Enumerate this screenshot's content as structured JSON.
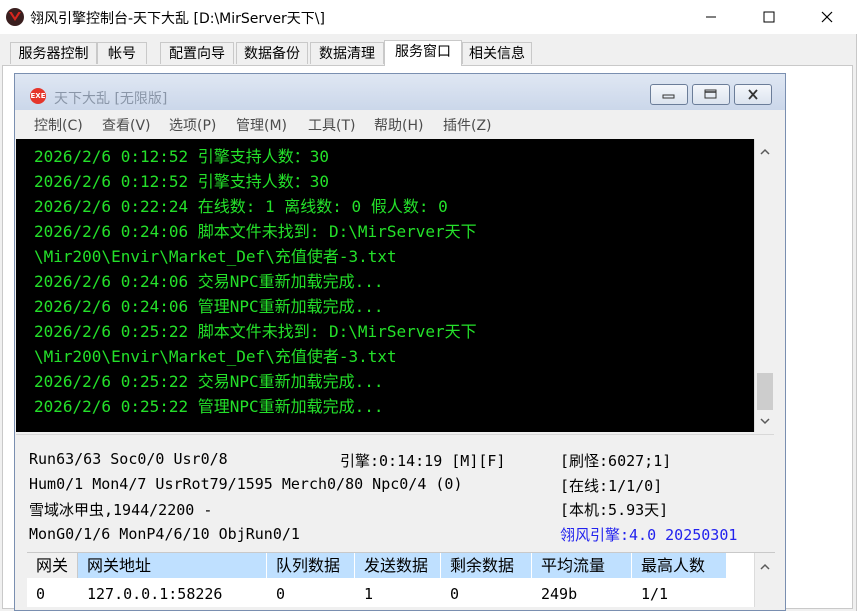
{
  "window": {
    "title": "翎风引擎控制台-天下大乱 [D:\\MirServer天下\\]"
  },
  "tabs": [
    {
      "label": "服务器控制",
      "active": false
    },
    {
      "label": "帐号",
      "active": false
    },
    {
      "label": "配置向导",
      "active": false
    },
    {
      "label": "数据备份",
      "active": false
    },
    {
      "label": "数据清理",
      "active": false
    },
    {
      "label": "服务窗口",
      "active": true
    },
    {
      "label": "相关信息",
      "active": false
    }
  ],
  "child": {
    "title": "天下大乱 [无限版]",
    "icon_label": "EXE",
    "menu": [
      "控制(C)",
      "查看(V)",
      "选项(P)",
      "管理(M)",
      "工具(T)",
      "帮助(H)",
      "插件(Z)"
    ]
  },
  "log": [
    {
      "text": "2026/2/6 0:12:52 引擎支持人数：30",
      "highlight": true
    },
    {
      "text": "2026/2/6 0:12:52 引擎支持人数：30",
      "highlight": true
    },
    {
      "text": "2026/2/6 0:22:24 在线数: 1 离线数: 0 假人数: 0",
      "highlight": false
    },
    {
      "text": "2026/2/6 0:24:06 脚本文件未找到: D:\\MirServer天下",
      "highlight": false
    },
    {
      "text": "\\Mir200\\Envir\\Market_Def\\充值使者-3.txt",
      "highlight": false
    },
    {
      "text": "2026/2/6 0:24:06 交易NPC重新加载完成...",
      "highlight": false
    },
    {
      "text": "2026/2/6 0:24:06 管理NPC重新加载完成...",
      "highlight": false
    },
    {
      "text": "2026/2/6 0:25:22 脚本文件未找到: D:\\MirServer天下",
      "highlight": false
    },
    {
      "text": "\\Mir200\\Envir\\Market_Def\\充值使者-3.txt",
      "highlight": false
    },
    {
      "text": "2026/2/6 0:25:22 交易NPC重新加载完成...",
      "highlight": false
    },
    {
      "text": "2026/2/6 0:25:22 管理NPC重新加载完成...",
      "highlight": false
    }
  ],
  "status": {
    "run": "Run63/63 Soc0/0 Usr0/8",
    "engine": "引擎:0:14:19 [M][F]",
    "refresh": "[刷怪:6027;1]",
    "hum": "Hum0/1 Mon4/7 UsrRot79/1595 Merch0/80 Npc0/4 (0)",
    "online": "[在线:1/1/0]",
    "map": "雪域冰甲虫,1944/2200 -",
    "local": "[本机:5.93天]",
    "mon": "MonG0/1/6 MonP4/6/10 ObjRun0/1",
    "version": "翎风引擎:4.0 20250301"
  },
  "gateway_table": {
    "headers": [
      "网关",
      "网关地址",
      "队列数据",
      "发送数据",
      "剩余数据",
      "平均流量",
      "最高人数"
    ],
    "rows": [
      [
        "0",
        "127.0.0.1:58226",
        "0",
        "1",
        "0",
        "249b",
        "1/1"
      ]
    ]
  }
}
